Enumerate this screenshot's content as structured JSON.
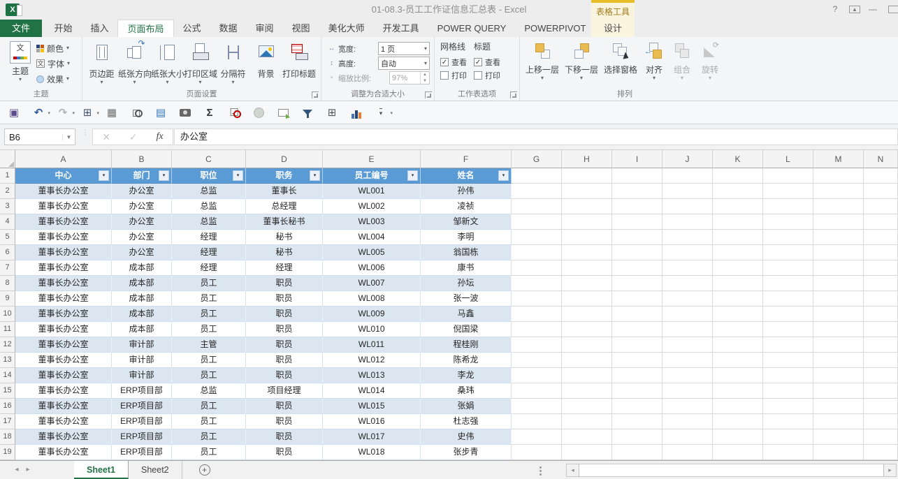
{
  "titlebar": {
    "title": "01-08.3-员工工作证信息汇总表 - Excel",
    "context_tool_label": "表格工具",
    "help_glyph": "?",
    "minimize_glyph": "—"
  },
  "tabs": {
    "file": "文件",
    "active": "页面布局",
    "items": [
      "开始",
      "插入",
      "页面布局",
      "公式",
      "数据",
      "审阅",
      "视图",
      "美化大师",
      "开发工具",
      "POWER QUERY",
      "POWERPIVOT"
    ],
    "contextual_tab": "设计"
  },
  "ribbon": {
    "themes": {
      "group_label": "主题",
      "main_button": "主题",
      "colors": "颜色",
      "fonts": "字体",
      "effects": "效果"
    },
    "page_setup": {
      "group_label": "页面设置",
      "buttons": [
        {
          "label": "页边距",
          "icon": "margins",
          "arrow": true
        },
        {
          "label": "纸张方向",
          "icon": "orient",
          "arrow": true
        },
        {
          "label": "纸张大小",
          "icon": "size",
          "arrow": true
        },
        {
          "label": "打印区域",
          "icon": "parea",
          "arrow": true
        },
        {
          "label": "分隔符",
          "icon": "breaks",
          "arrow": true
        },
        {
          "label": "背景",
          "icon": "bg",
          "arrow": false
        },
        {
          "label": "打印标题",
          "icon": "ptitles",
          "arrow": false
        }
      ]
    },
    "scale_to_fit": {
      "group_label": "调整为合适大小",
      "width_label": "宽度:",
      "width_value": "1 页",
      "height_label": "高度:",
      "height_value": "自动",
      "scale_label": "缩放比例:",
      "scale_value": "97%"
    },
    "sheet_options": {
      "group_label": "工作表选项",
      "gridlines_label": "网格线",
      "headings_label": "标题",
      "view_label": "查看",
      "print_label": "打印",
      "gridlines_view_checked": true,
      "gridlines_print_checked": false,
      "headings_view_checked": true,
      "headings_print_checked": false
    },
    "arrange": {
      "group_label": "排列",
      "buttons": [
        {
          "label": "上移一层",
          "icon": "fwd",
          "arrow": true,
          "disabled": false,
          "wide": true
        },
        {
          "label": "下移一层",
          "icon": "back",
          "arrow": true,
          "disabled": false,
          "wide": true
        },
        {
          "label": "选择窗格",
          "icon": "sel",
          "arrow": false,
          "disabled": false,
          "wide": true
        },
        {
          "label": "对齐",
          "icon": "align",
          "arrow": true,
          "disabled": false,
          "wide": false
        },
        {
          "label": "组合",
          "icon": "group",
          "arrow": true,
          "disabled": true,
          "wide": false
        },
        {
          "label": "旋转",
          "icon": "rotate",
          "arrow": true,
          "disabled": true,
          "wide": false
        }
      ]
    }
  },
  "qat": {
    "icons": [
      "save",
      "undo",
      "redo",
      "grid-window",
      "borders",
      "print-preview",
      "form-view",
      "camera",
      "autosum",
      "data-validation",
      "shape-oval",
      "new-comment",
      "filter",
      "insert-table",
      "chart",
      "more-commands"
    ]
  },
  "formula_bar": {
    "cell_ref": "B6",
    "fx_label": "fx",
    "formula": "办公室"
  },
  "sheet": {
    "column_letters": [
      "A",
      "B",
      "C",
      "D",
      "E",
      "F",
      "G",
      "H",
      "I",
      "J",
      "K",
      "L",
      "M",
      "N"
    ],
    "table_headers": [
      "中心",
      "部门",
      "职位",
      "职务",
      "员工编号",
      "姓名"
    ],
    "rows": [
      [
        "董事长办公室",
        "办公室",
        "总监",
        "董事长",
        "WL001",
        "孙伟"
      ],
      [
        "董事长办公室",
        "办公室",
        "总监",
        "总经理",
        "WL002",
        "凌祯"
      ],
      [
        "董事长办公室",
        "办公室",
        "总监",
        "董事长秘书",
        "WL003",
        "邹新文"
      ],
      [
        "董事长办公室",
        "办公室",
        "经理",
        "秘书",
        "WL004",
        "李明"
      ],
      [
        "董事长办公室",
        "办公室",
        "经理",
        "秘书",
        "WL005",
        "翁国栋"
      ],
      [
        "董事长办公室",
        "成本部",
        "经理",
        "经理",
        "WL006",
        "康书"
      ],
      [
        "董事长办公室",
        "成本部",
        "员工",
        "职员",
        "WL007",
        "孙坛"
      ],
      [
        "董事长办公室",
        "成本部",
        "员工",
        "职员",
        "WL008",
        "张一波"
      ],
      [
        "董事长办公室",
        "成本部",
        "员工",
        "职员",
        "WL009",
        "马鑫"
      ],
      [
        "董事长办公室",
        "成本部",
        "员工",
        "职员",
        "WL010",
        "倪国梁"
      ],
      [
        "董事长办公室",
        "审计部",
        "主管",
        "职员",
        "WL011",
        "程桂刚"
      ],
      [
        "董事长办公室",
        "审计部",
        "员工",
        "职员",
        "WL012",
        "陈希龙"
      ],
      [
        "董事长办公室",
        "审计部",
        "员工",
        "职员",
        "WL013",
        "李龙"
      ],
      [
        "董事长办公室",
        "ERP项目部",
        "总监",
        "项目经理",
        "WL014",
        "桑玮"
      ],
      [
        "董事长办公室",
        "ERP项目部",
        "员工",
        "职员",
        "WL015",
        "张娟"
      ],
      [
        "董事长办公室",
        "ERP项目部",
        "员工",
        "职员",
        "WL016",
        "杜志强"
      ],
      [
        "董事长办公室",
        "ERP项目部",
        "员工",
        "职员",
        "WL017",
        "史伟"
      ],
      [
        "董事长办公室",
        "ERP项目部",
        "员工",
        "职员",
        "WL018",
        "张步青"
      ]
    ]
  },
  "sheet_tabs": {
    "tabs": [
      "Sheet1",
      "Sheet2"
    ],
    "active": "Sheet1"
  },
  "colors": {
    "excel_green": "#217346",
    "table_header_blue": "#5B9BD5",
    "band_blue": "#DCE6F1",
    "context_gold": "#E5BE28"
  }
}
